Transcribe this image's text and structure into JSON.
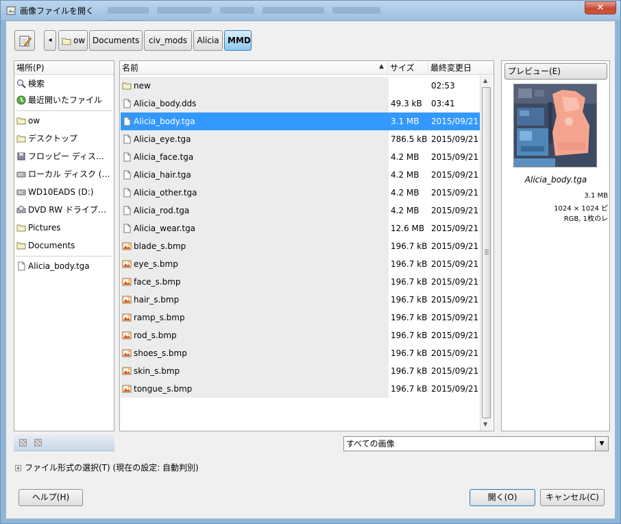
{
  "window": {
    "title": "画像ファイルを開く",
    "close_label": "✕"
  },
  "toolbar": {
    "edit_icon": "edit-location-icon",
    "back_label": "◂",
    "breadcrumbs": [
      {
        "label": "ow"
      },
      {
        "label": "Documents"
      },
      {
        "label": "civ_mods"
      },
      {
        "label": "Alicia"
      },
      {
        "label": "MMD"
      }
    ]
  },
  "places": {
    "header": "場所(P)",
    "items": [
      {
        "label": "検索",
        "icon": "search-icon"
      },
      {
        "label": "最近開いたファイル",
        "icon": "recent-icon"
      },
      {
        "label": "ow",
        "icon": "folder-icon"
      },
      {
        "label": "デスクトップ",
        "icon": "folder-icon"
      },
      {
        "label": "フロッピー ディス…",
        "icon": "floppy-icon"
      },
      {
        "label": "ローカル ディスク (…",
        "icon": "disk-icon"
      },
      {
        "label": "WD10EADS (D:)",
        "icon": "disk-icon"
      },
      {
        "label": "DVD RW ドライブ…",
        "icon": "dvd-icon"
      },
      {
        "label": "Pictures",
        "icon": "folder-icon"
      },
      {
        "label": "Documents",
        "icon": "folder-icon"
      },
      {
        "label": "Alicia_body.tga",
        "icon": "file-icon"
      }
    ]
  },
  "files": {
    "columns": {
      "name": "名前",
      "size": "サイズ",
      "modified": "最終変更日"
    },
    "sort_indicator": "▲",
    "rows": [
      {
        "name": "new",
        "size": "",
        "modified": "02:53",
        "icon": "folder-icon"
      },
      {
        "name": "Alicia_body.dds",
        "size": "49.3 kB",
        "modified": "03:41",
        "icon": "file-icon"
      },
      {
        "name": "Alicia_body.tga",
        "size": "3.1 MB",
        "modified": "2015/09/21",
        "icon": "file-icon"
      },
      {
        "name": "Alicia_eye.tga",
        "size": "786.5 kB",
        "modified": "2015/09/21",
        "icon": "file-icon"
      },
      {
        "name": "Alicia_face.tga",
        "size": "4.2 MB",
        "modified": "2015/09/21",
        "icon": "file-icon"
      },
      {
        "name": "Alicia_hair.tga",
        "size": "4.2 MB",
        "modified": "2015/09/21",
        "icon": "file-icon"
      },
      {
        "name": "Alicia_other.tga",
        "size": "4.2 MB",
        "modified": "2015/09/21",
        "icon": "file-icon"
      },
      {
        "name": "Alicia_rod.tga",
        "size": "4.2 MB",
        "modified": "2015/09/21",
        "icon": "file-icon"
      },
      {
        "name": "Alicia_wear.tga",
        "size": "12.6 MB",
        "modified": "2015/09/21",
        "icon": "file-icon"
      },
      {
        "name": "blade_s.bmp",
        "size": "196.7 kB",
        "modified": "2015/09/21",
        "icon": "image-icon"
      },
      {
        "name": "eye_s.bmp",
        "size": "196.7 kB",
        "modified": "2015/09/21",
        "icon": "image-icon"
      },
      {
        "name": "face_s.bmp",
        "size": "196.7 kB",
        "modified": "2015/09/21",
        "icon": "image-icon"
      },
      {
        "name": "hair_s.bmp",
        "size": "196.7 kB",
        "modified": "2015/09/21",
        "icon": "image-icon"
      },
      {
        "name": "ramp_s.bmp",
        "size": "196.7 kB",
        "modified": "2015/09/21",
        "icon": "image-icon"
      },
      {
        "name": "rod_s.bmp",
        "size": "196.7 kB",
        "modified": "2015/09/21",
        "icon": "image-icon"
      },
      {
        "name": "shoes_s.bmp",
        "size": "196.7 kB",
        "modified": "2015/09/21",
        "icon": "image-icon"
      },
      {
        "name": "skin_s.bmp",
        "size": "196.7 kB",
        "modified": "2015/09/21",
        "icon": "image-icon"
      },
      {
        "name": "tongue_s.bmp",
        "size": "196.7 kB",
        "modified": "2015/09/21",
        "icon": "image-icon"
      }
    ],
    "selected_index": 2
  },
  "preview": {
    "button_label": "プレビュー(E)",
    "file_name": "Alicia_body.tga",
    "size": "3.1 MB",
    "dimensions": "1024 × 1024 ピ",
    "color_info": "RGB, 1枚のレ"
  },
  "filter": {
    "selected": "すべての画像"
  },
  "file_type": {
    "label": "ファイル形式の選択(T) (現在の設定: 自動判別)",
    "expander": "+"
  },
  "buttons": {
    "help": "ヘルプ(H)",
    "open": "開く(O)",
    "cancel": "キャンセル(C)"
  },
  "colors": {
    "selection": "#3399ff",
    "title_bar": "#9fc1e0",
    "close": "#c94a32"
  }
}
